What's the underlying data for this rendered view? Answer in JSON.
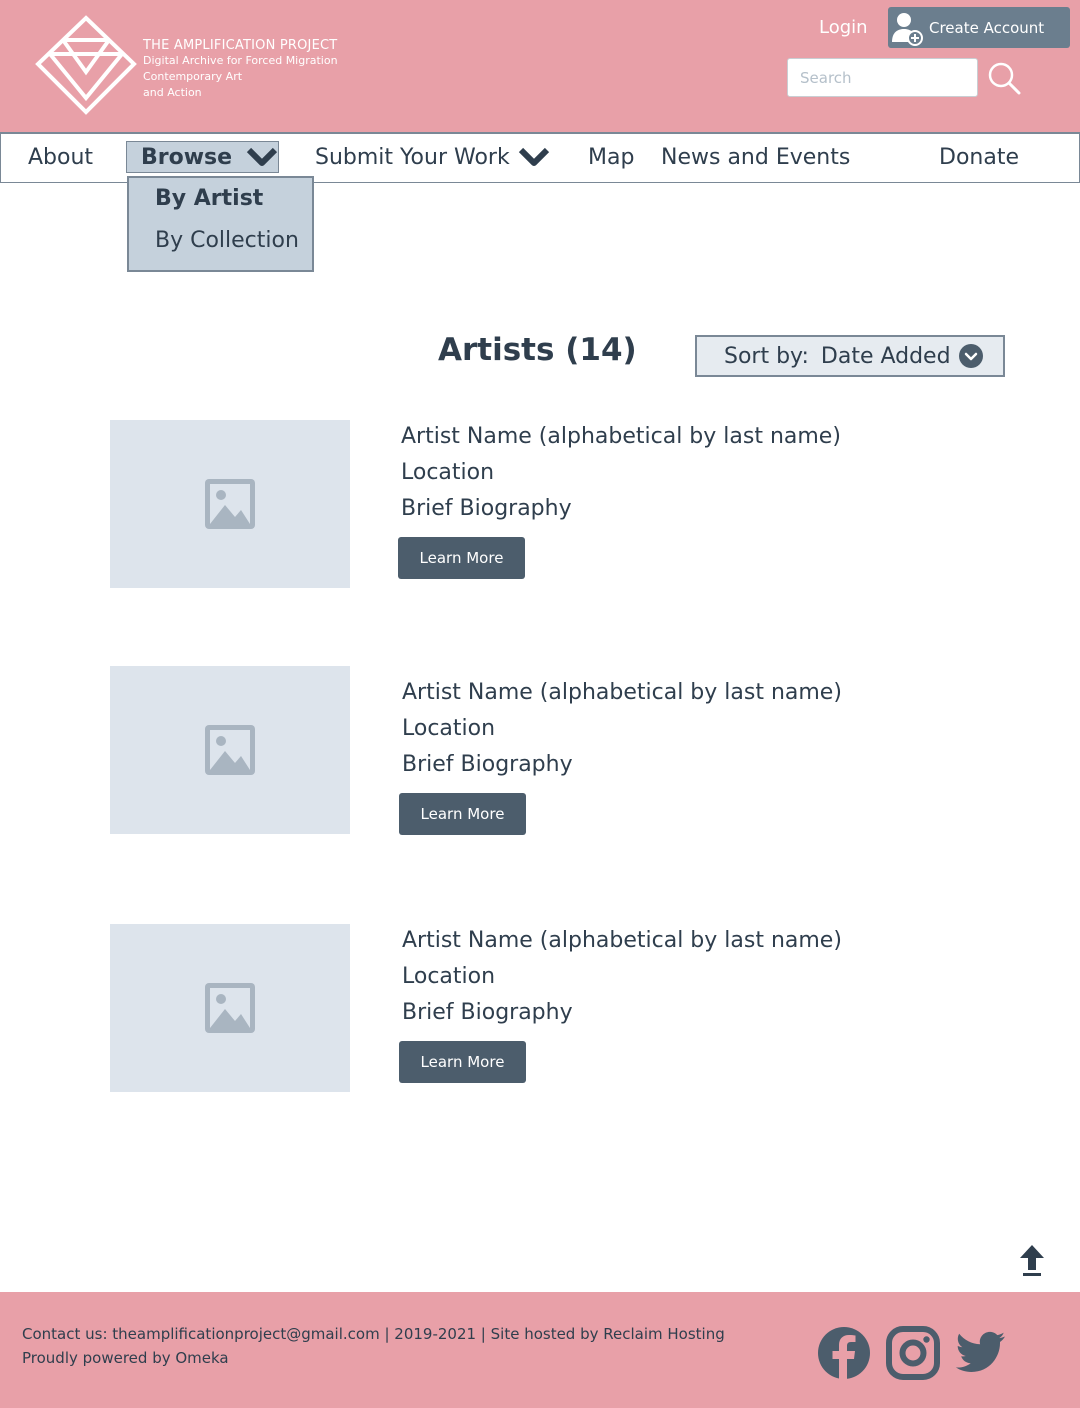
{
  "header": {
    "logo_title": "THE AMPLIFICATION PROJECT",
    "logo_subtitle_lines": [
      "Digital Archive for Forced Migration",
      "Contemporary Art",
      "and Action"
    ],
    "login_label": "Login",
    "create_account_label": "Create Account",
    "search_placeholder": "Search"
  },
  "nav": {
    "items": [
      "About",
      "Browse",
      "Submit Your Work",
      "Map",
      "News and Events",
      "Donate"
    ],
    "browse_dropdown": [
      "By Artist",
      "By Collection"
    ]
  },
  "main": {
    "title": "Artists (14)",
    "sort_label": "Sort by:",
    "sort_value": "Date Added",
    "artists": [
      {
        "name": "Artist Name  (alphabetical by last name)",
        "location": "Location",
        "bio": "Brief Biography",
        "button": "Learn More"
      },
      {
        "name": "Artist Name  (alphabetical by last name)",
        "location": "Location",
        "bio": "Brief Biography",
        "button": "Learn More"
      },
      {
        "name": "Artist Name  (alphabetical by last name)",
        "location": "Location",
        "bio": "Brief Biography",
        "button": "Learn More"
      }
    ]
  },
  "footer": {
    "line1": "Contact us: theamplificationproject@gmail.com | 2019-2021 | Site hosted by Reclaim Hosting",
    "line2": "Proudly powered by Omeka",
    "social_icons": [
      "facebook-icon",
      "instagram-icon",
      "twitter-icon"
    ]
  },
  "colors": {
    "brand_pink": "#e8a0a8",
    "nav_highlight": "#c5d1dc",
    "text_dark": "#2f3e4d",
    "button_dark": "#4c5d6c",
    "create_account_bg": "#6b7e8e",
    "image_placeholder": "#dde4ec"
  }
}
